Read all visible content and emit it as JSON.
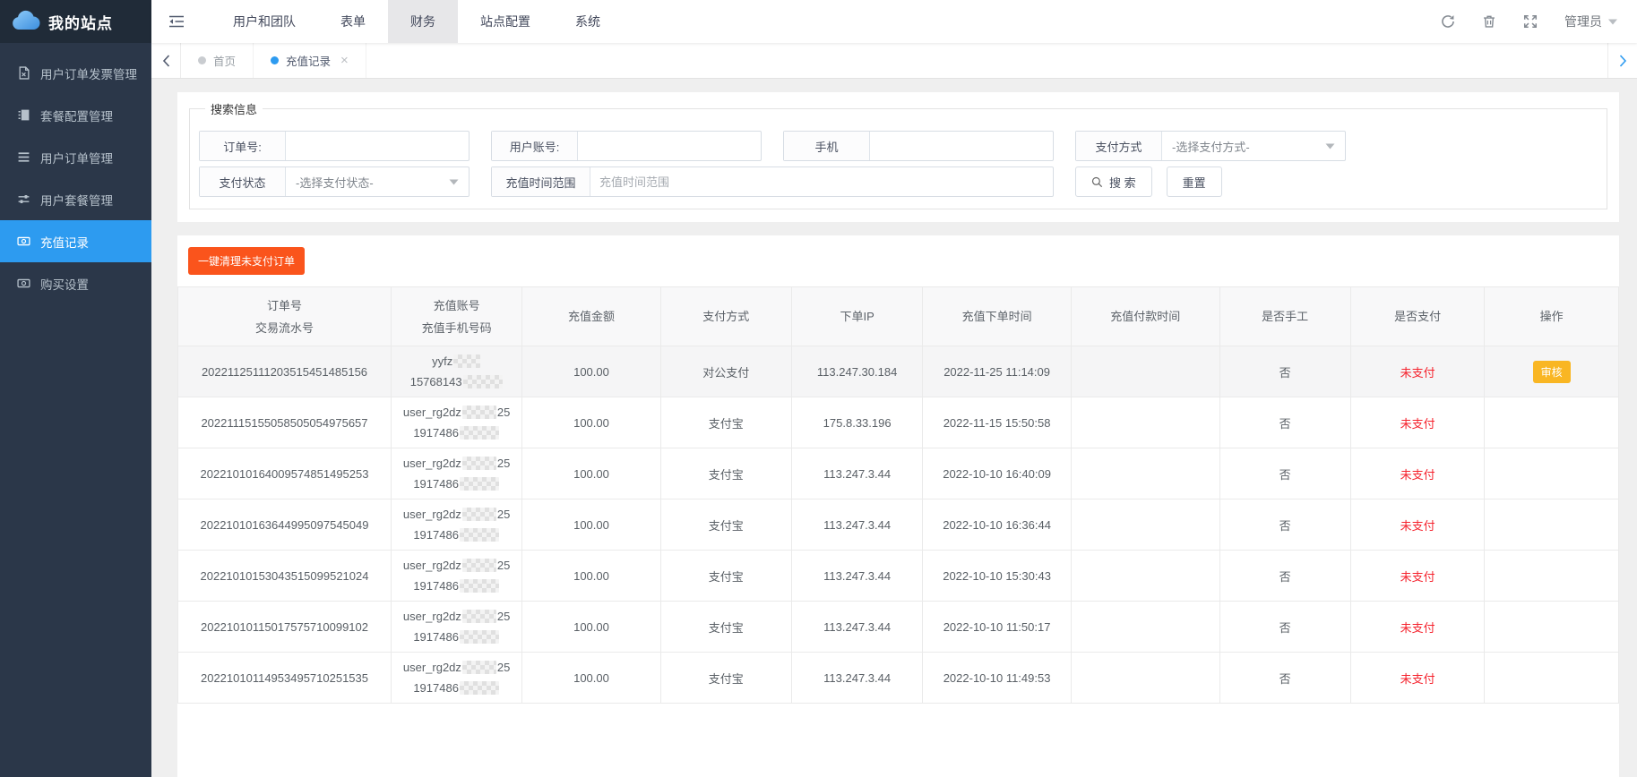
{
  "brand": {
    "title": "我的站点"
  },
  "colors": {
    "accent-blue": "#2d9bf0",
    "orange": "#fa541c",
    "audit-yellow": "#f9b623",
    "unpaid-red": "#f5222d"
  },
  "sidebar": {
    "items": [
      {
        "label": "用户订单发票管理",
        "icon": "invoice-icon",
        "active": false
      },
      {
        "label": "套餐配置管理",
        "icon": "package-icon",
        "active": false
      },
      {
        "label": "用户订单管理",
        "icon": "order-list-icon",
        "active": false
      },
      {
        "label": "用户套餐管理",
        "icon": "user-package-icon",
        "active": false
      },
      {
        "label": "充值记录",
        "icon": "recharge-record-icon",
        "active": true
      },
      {
        "label": "购买设置",
        "icon": "purchase-settings-icon",
        "active": false
      }
    ]
  },
  "navbar": {
    "items": [
      {
        "label": "用户和团队",
        "active": false
      },
      {
        "label": "表单",
        "active": false
      },
      {
        "label": "财务",
        "active": true
      },
      {
        "label": "站点配置",
        "active": false
      },
      {
        "label": "系统",
        "active": false
      }
    ],
    "user": "管理员"
  },
  "tabbar": {
    "tabs": [
      {
        "label": "首页",
        "active": false,
        "closable": false
      },
      {
        "label": "充值记录",
        "active": true,
        "closable": true
      }
    ]
  },
  "search": {
    "legend": "搜索信息",
    "order_no_label": "订单号:",
    "order_no_value": "",
    "account_label": "用户账号:",
    "account_value": "",
    "phone_label": "手机",
    "phone_value": "",
    "pay_method_label": "支付方式",
    "pay_method_selected": "-选择支付方式-",
    "pay_status_label": "支付状态",
    "pay_status_selected": "-选择支付状态-",
    "time_range_label": "充值时间范围",
    "time_range_placeholder": "充值时间范围",
    "search_button": "搜 索",
    "reset_button": "重置"
  },
  "table": {
    "clear_button": "一键清理未支付订单",
    "columns": [
      {
        "lines": [
          "订单号",
          "交易流水号"
        ]
      },
      {
        "lines": [
          "充值账号",
          "充值手机号码"
        ]
      },
      {
        "lines": [
          "充值金额"
        ]
      },
      {
        "lines": [
          "支付方式"
        ]
      },
      {
        "lines": [
          "下单IP"
        ]
      },
      {
        "lines": [
          "充值下单时间"
        ]
      },
      {
        "lines": [
          "充值付款时间"
        ]
      },
      {
        "lines": [
          "是否手工"
        ]
      },
      {
        "lines": [
          "是否支付"
        ]
      },
      {
        "lines": [
          "操作"
        ]
      }
    ],
    "rows": [
      {
        "order_no": "20221125111203515451485156",
        "account_prefix": "yyfz",
        "account_suffix": "",
        "phone_prefix": "15768143",
        "redacted": true,
        "amount": "100.00",
        "pay_method": "对公支付",
        "ip": "113.247.30.184",
        "order_time": "2022-11-25 11:14:09",
        "pay_time": "",
        "manual": "否",
        "paid": "未支付",
        "action": "审核"
      },
      {
        "order_no": "20221115155058505054975657",
        "account_prefix": "user_rg2dz",
        "account_suffix": "25",
        "phone_prefix": "1917486",
        "redacted": true,
        "amount": "100.00",
        "pay_method": "支付宝",
        "ip": "175.8.33.196",
        "order_time": "2022-11-15 15:50:58",
        "pay_time": "",
        "manual": "否",
        "paid": "未支付",
        "action": ""
      },
      {
        "order_no": "20221010164009574851495253",
        "account_prefix": "user_rg2dz",
        "account_suffix": "25",
        "phone_prefix": "1917486",
        "redacted": true,
        "amount": "100.00",
        "pay_method": "支付宝",
        "ip": "113.247.3.44",
        "order_time": "2022-10-10 16:40:09",
        "pay_time": "",
        "manual": "否",
        "paid": "未支付",
        "action": ""
      },
      {
        "order_no": "20221010163644995097545049",
        "account_prefix": "user_rg2dz",
        "account_suffix": "25",
        "phone_prefix": "1917486",
        "redacted": true,
        "amount": "100.00",
        "pay_method": "支付宝",
        "ip": "113.247.3.44",
        "order_time": "2022-10-10 16:36:44",
        "pay_time": "",
        "manual": "否",
        "paid": "未支付",
        "action": ""
      },
      {
        "order_no": "20221010153043515099521024",
        "account_prefix": "user_rg2dz",
        "account_suffix": "25",
        "phone_prefix": "1917486",
        "redacted": true,
        "amount": "100.00",
        "pay_method": "支付宝",
        "ip": "113.247.3.44",
        "order_time": "2022-10-10 15:30:43",
        "pay_time": "",
        "manual": "否",
        "paid": "未支付",
        "action": ""
      },
      {
        "order_no": "20221010115017575710099102",
        "account_prefix": "user_rg2dz",
        "account_suffix": "25",
        "phone_prefix": "1917486",
        "redacted": true,
        "amount": "100.00",
        "pay_method": "支付宝",
        "ip": "113.247.3.44",
        "order_time": "2022-10-10 11:50:17",
        "pay_time": "",
        "manual": "否",
        "paid": "未支付",
        "action": ""
      },
      {
        "order_no": "20221010114953495710251535",
        "account_prefix": "user_rg2dz",
        "account_suffix": "25",
        "phone_prefix": "1917486",
        "redacted": true,
        "amount": "100.00",
        "pay_method": "支付宝",
        "ip": "113.247.3.44",
        "order_time": "2022-10-10 11:49:53",
        "pay_time": "",
        "manual": "否",
        "paid": "未支付",
        "action": ""
      }
    ]
  }
}
